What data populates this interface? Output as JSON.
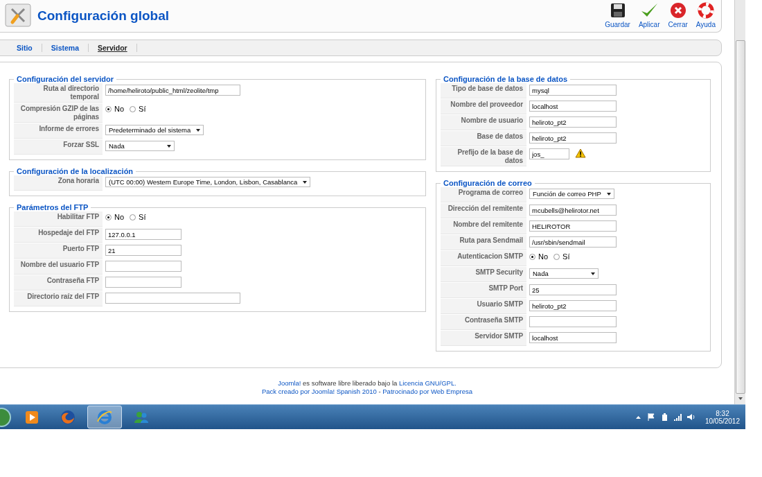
{
  "header": {
    "title": "Configuración global"
  },
  "toolbar": [
    {
      "kind": "save",
      "label": "Guardar"
    },
    {
      "kind": "apply",
      "label": "Aplicar"
    },
    {
      "kind": "close",
      "label": "Cerrar"
    },
    {
      "kind": "help",
      "label": "Ayuda"
    }
  ],
  "tabs": [
    {
      "label": "Sitio",
      "selected": false
    },
    {
      "label": "Sistema",
      "selected": false
    },
    {
      "label": "Servidor",
      "selected": true
    }
  ],
  "columns": [
    [
      {
        "legend": "Configuración del servidor",
        "rows": [
          {
            "label": "Ruta al directorio temporal",
            "kind": "wide",
            "value": "/home/heliroto/public_html/zeolite/tmp"
          },
          {
            "label": "Compresión GZIP de las páginas",
            "kind": "radio",
            "options": [
              {
                "label": "No",
                "selected": true
              },
              {
                "label": "Sí",
                "selected": false
              }
            ]
          },
          {
            "label": "Informe de errores",
            "kind": "select",
            "value": "Predeterminado del sistema"
          },
          {
            "label": "Forzar SSL",
            "kind": "select",
            "value": "Nada"
          }
        ]
      },
      {
        "legend": "Configuración de la localización",
        "rows": [
          {
            "label": "Zona horaria",
            "kind": "select",
            "value": "(UTC 00:00) Western Europe Time, London, Lisbon, Casablanca"
          }
        ]
      },
      {
        "legend": "Parámetros del FTP",
        "rows": [
          {
            "label": "Habilitar FTP",
            "kind": "radio",
            "options": [
              {
                "label": "No",
                "selected": true
              },
              {
                "label": "Sí",
                "selected": false
              }
            ]
          },
          {
            "label": "Hospedaje del FTP",
            "kind": "text",
            "value": "127.0.0.1"
          },
          {
            "label": "Puerto FTP",
            "kind": "text",
            "value": "21"
          },
          {
            "label": "Nombre del usuario FTP",
            "kind": "text"
          },
          {
            "label": "Contraseña FTP",
            "kind": "text"
          },
          {
            "label": "Directorio raíz del FTP",
            "kind": "wide"
          }
        ]
      }
    ],
    [
      {
        "legend": "Configuración de la base de datos",
        "rows": [
          {
            "label": "Tipo de base de datos",
            "kind": "text",
            "value": "mysql"
          },
          {
            "label": "Nombre del proveedor",
            "kind": "text",
            "value": "localhost"
          },
          {
            "label": "Nombre de usuario",
            "kind": "text",
            "value": "heliroto_pt2"
          },
          {
            "label": "Base de datos",
            "kind": "text",
            "value": "heliroto_pt2"
          },
          {
            "label": "Prefijo de la base de datos",
            "kind": "short",
            "value": "jos_",
            "warning": true
          }
        ]
      },
      {
        "legend": "Configuración de correo",
        "rows": [
          {
            "label": "Programa de correo",
            "kind": "select",
            "value": "Función de correo PHP"
          },
          {
            "label": "Dirección del remitente",
            "kind": "text",
            "value": "mcubells@helirotor.net"
          },
          {
            "label": "Nombre del remitente",
            "kind": "text",
            "value": "HELIROTOR"
          },
          {
            "label": "Ruta para Sendmail",
            "kind": "text",
            "value": "/usr/sbin/sendmail"
          },
          {
            "label": "Autenticacion SMTP",
            "kind": "radio",
            "options": [
              {
                "label": "No",
                "selected": true
              },
              {
                "label": "Sí",
                "selected": false
              }
            ]
          },
          {
            "label": "SMTP Security",
            "kind": "select",
            "value": "Nada"
          },
          {
            "label": "SMTP Port",
            "kind": "text",
            "value": "25"
          },
          {
            "label": "Usuario SMTP",
            "kind": "text",
            "value": "heliroto_pt2"
          },
          {
            "label": "Contraseña SMTP",
            "kind": "text"
          },
          {
            "label": "Servidor SMTP",
            "kind": "text",
            "value": "localhost"
          }
        ]
      }
    ]
  ],
  "footer": [
    [
      {
        "text": "Joomla!",
        "link": true
      },
      {
        "text": " es software libre liberado bajo la ",
        "link": false
      },
      {
        "text": "Licencia GNU/GPL.",
        "link": true
      }
    ],
    [
      {
        "text": "Pack creado por Joomla! Spanish 2010",
        "link": true
      },
      {
        "text": " - ",
        "link": false
      },
      {
        "text": "Patrocinado por Web Empresa",
        "link": true
      }
    ]
  ],
  "taskbar": {
    "apps": [
      {
        "kind": "media",
        "selected": false
      },
      {
        "kind": "firefox",
        "selected": false
      },
      {
        "kind": "ie",
        "selected": true
      },
      {
        "kind": "messenger",
        "selected": false
      }
    ],
    "time": "8:32",
    "date": "10/05/2012"
  }
}
